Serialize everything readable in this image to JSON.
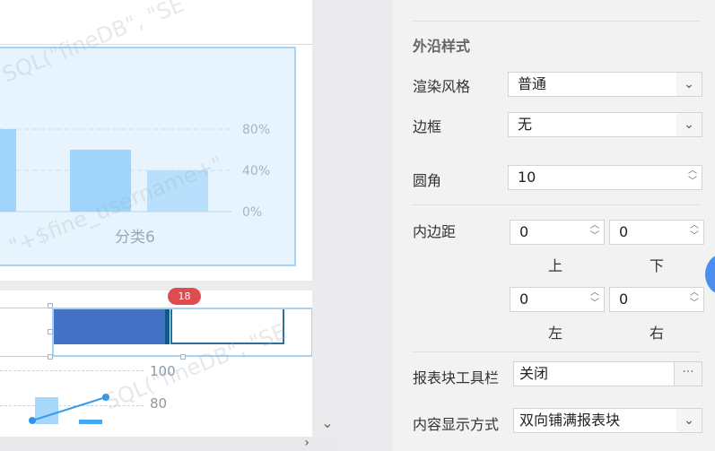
{
  "canvas": {
    "chart_data": {
      "type": "bar",
      "categories": [
        "",
        "分类6",
        ""
      ],
      "series": [
        {
          "values": [
            80,
            60,
            40
          ]
        }
      ],
      "y_ticks": [
        "80%",
        "40%",
        "0%"
      ],
      "ylim": [
        0,
        100
      ],
      "grid": true,
      "category_label": "分类6"
    },
    "badge": "18",
    "mini_ticks": [
      "100",
      "80"
    ],
    "colors": {
      "bar": "#9fd4fb",
      "fill": "#4472c4",
      "badge": "#e04b50"
    }
  },
  "watermarks": [
    "SQL(\"fineDB\", \"SE",
    "\"+$fine_username+\"",
    "SQL(\"fineDB\", \"SE"
  ],
  "panel": {
    "section_title": "外沿样式",
    "rows": {
      "render_style": {
        "label": "渲染风格",
        "value": "普通"
      },
      "border": {
        "label": "边框",
        "value": "无"
      },
      "radius": {
        "label": "圆角",
        "value": "10"
      },
      "padding": {
        "label": "内边距",
        "top": {
          "value": "0",
          "label": "上"
        },
        "bottom": {
          "value": "0",
          "label": "下"
        },
        "left": {
          "value": "0",
          "label": "左"
        },
        "right": {
          "value": "0",
          "label": "右"
        }
      },
      "toolbar": {
        "label": "报表块工具栏",
        "value": "关闭",
        "more": "···"
      },
      "display_mode": {
        "label": "内容显示方式",
        "value": "双向铺满报表块"
      }
    }
  },
  "icons": {
    "dropdown": "chevron-down-icon",
    "spinner": "spinner-arrows-icon",
    "edit": "edit-icon",
    "lock": "unlock-icon",
    "scroll_down": "chevron-down-icon",
    "scroll_right": "chevron-right-icon"
  }
}
